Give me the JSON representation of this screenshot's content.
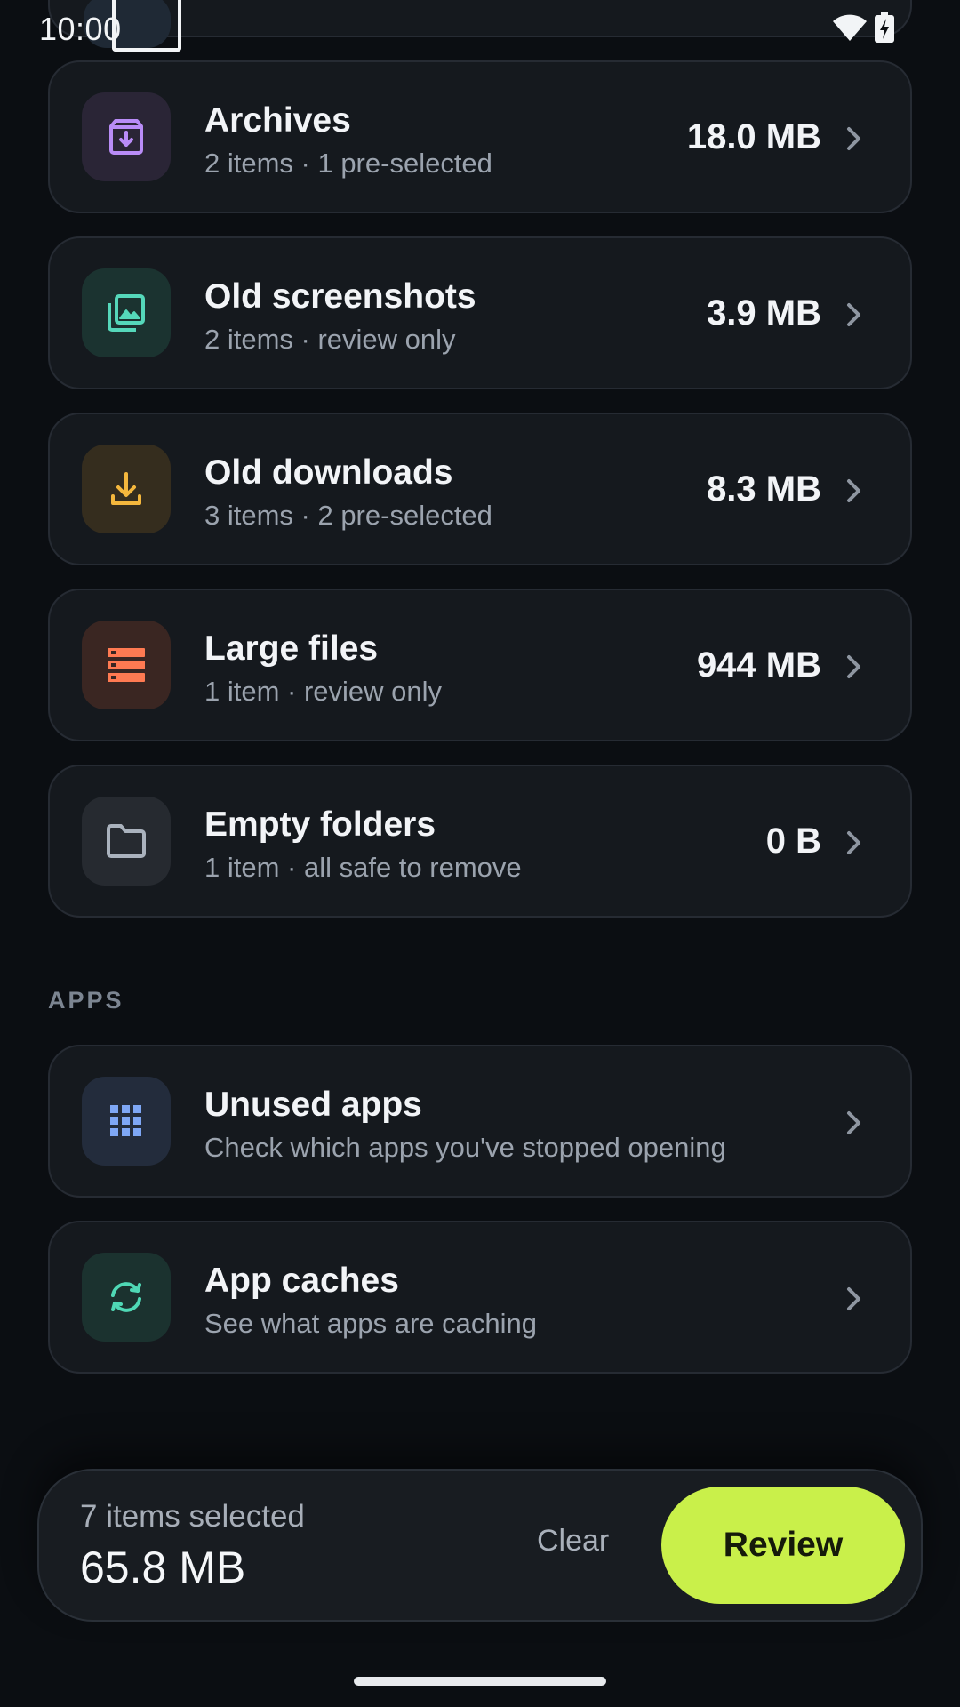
{
  "status_bar": {
    "time": "10:00"
  },
  "cleanup_items": [
    {
      "title": "Archives",
      "subtitle": "2 items · 1 pre-selected",
      "size": "18.0 MB",
      "icon": "archive-icon"
    },
    {
      "title": "Old screenshots",
      "subtitle": "2 items · review only",
      "size": "3.9 MB",
      "icon": "image-icon"
    },
    {
      "title": "Old downloads",
      "subtitle": "3 items · 2 pre-selected",
      "size": "8.3 MB",
      "icon": "download-icon"
    },
    {
      "title": "Large files",
      "subtitle": "1 item · review only",
      "size": "944 MB",
      "icon": "storage-icon"
    },
    {
      "title": "Empty folders",
      "subtitle": "1 item · all safe to remove",
      "size": "0 B",
      "icon": "folder-icon"
    }
  ],
  "apps_section": {
    "label": "APPS",
    "items": [
      {
        "title": "Unused apps",
        "subtitle": "Check which apps you've stopped opening",
        "icon": "apps-grid-icon"
      },
      {
        "title": "App caches",
        "subtitle": "See what apps are caching",
        "icon": "refresh-icon"
      }
    ]
  },
  "selection_bar": {
    "count_text": "7 items selected",
    "total_size": "65.8 MB",
    "clear_label": "Clear",
    "review_label": "Review"
  },
  "colors": {
    "accent": "#c9f04a",
    "background": "#0b0e12",
    "card": "#15191e",
    "archive": "#b98cf7",
    "image": "#55d8ba",
    "download": "#f4b73d",
    "storage": "#ff7a52",
    "folder": "#aab2bd",
    "apps": "#7ea7f5",
    "refresh": "#4fd8b5"
  }
}
